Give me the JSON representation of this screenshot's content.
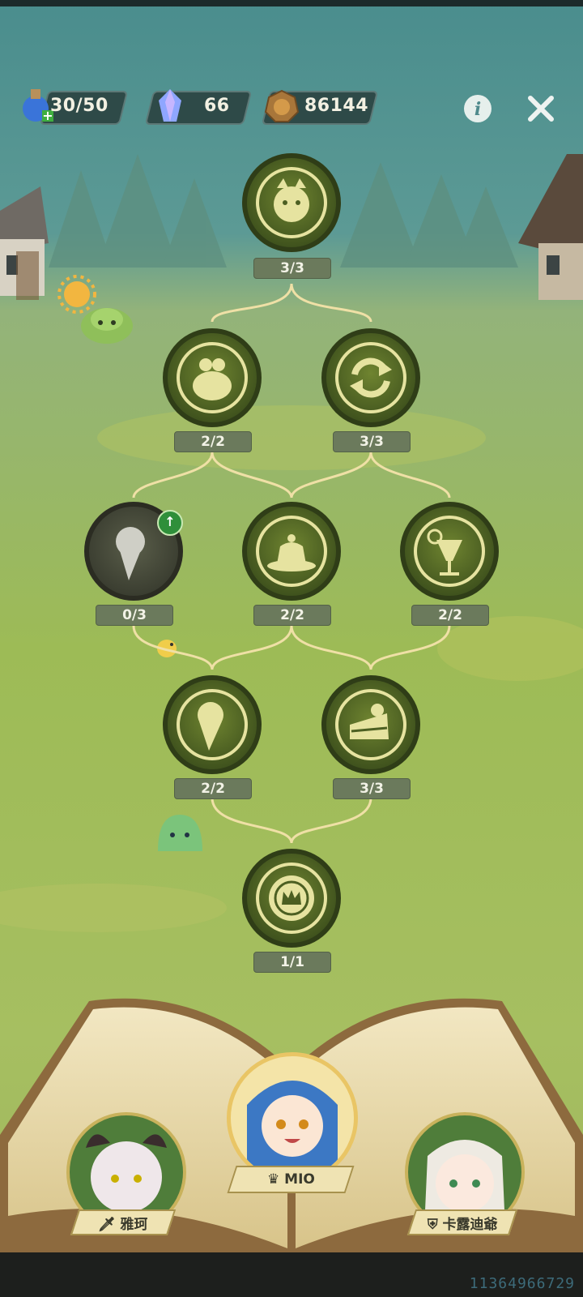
{
  "resources": {
    "stamina": {
      "value": "30/50",
      "icon": "potion-icon"
    },
    "gems": {
      "value": "66",
      "icon": "crystal-icon"
    },
    "coins": {
      "value": "86144",
      "icon": "pumpkin-coin-icon"
    }
  },
  "tree": {
    "top": {
      "icon": "character-face-icon",
      "progress": "3/3"
    },
    "row2": [
      {
        "icon": "money-bag-icon",
        "progress": "2/2"
      },
      {
        "icon": "refresh-icon",
        "progress": "3/3"
      }
    ],
    "row3": [
      {
        "icon": "ice-cream-icon",
        "progress": "0/3",
        "locked": true
      },
      {
        "icon": "pudding-icon",
        "progress": "2/2"
      },
      {
        "icon": "cocktail-icon",
        "progress": "2/2"
      }
    ],
    "row4": [
      {
        "icon": "ice-cream-icon",
        "progress": "2/2"
      },
      {
        "icon": "cake-icon",
        "progress": "3/3"
      }
    ],
    "root": {
      "icon": "crown-seal-icon",
      "progress": "1/1"
    }
  },
  "characters": {
    "left": {
      "name": "雅珂",
      "role_icon": "sword-icon"
    },
    "center": {
      "name": "MIO",
      "role_icon": "crown-icon"
    },
    "right": {
      "name": "卡露迪爺",
      "role_icon": "shield-icon"
    }
  },
  "uid": "11364966729",
  "colors": {
    "node_ring": "#e6e3a0",
    "node_fill": "#4c5f22",
    "connector": "#efe0a6"
  }
}
